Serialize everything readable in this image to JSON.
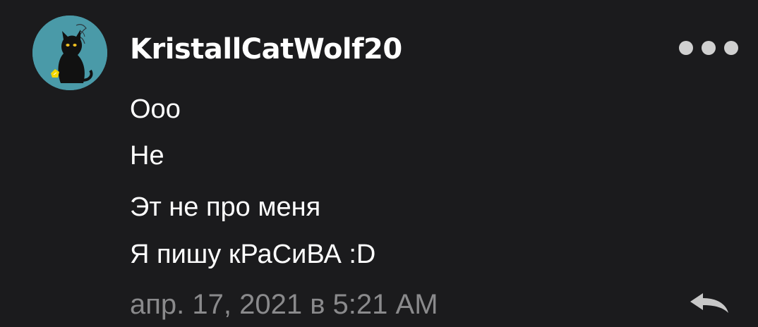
{
  "comment": {
    "author": {
      "username": "KristallCatWolf20",
      "avatar_icon": "black-cat-avatar-icon",
      "avatar_background": "#4a9aa8"
    },
    "message_lines": [
      "Ооо",
      "Не",
      "Эт не про меня",
      "Я пишу кРаСиВА :D"
    ],
    "timestamp": "апр. 17, 2021 в 5:21 AM",
    "actions": {
      "more_icon": "more-horizontal-icon",
      "reply_icon": "reply-arrow-icon"
    }
  },
  "colors": {
    "background": "#1b1b1d",
    "text": "#ffffff",
    "muted_text": "#8a8a8c",
    "icon": "#d0d0d0"
  }
}
